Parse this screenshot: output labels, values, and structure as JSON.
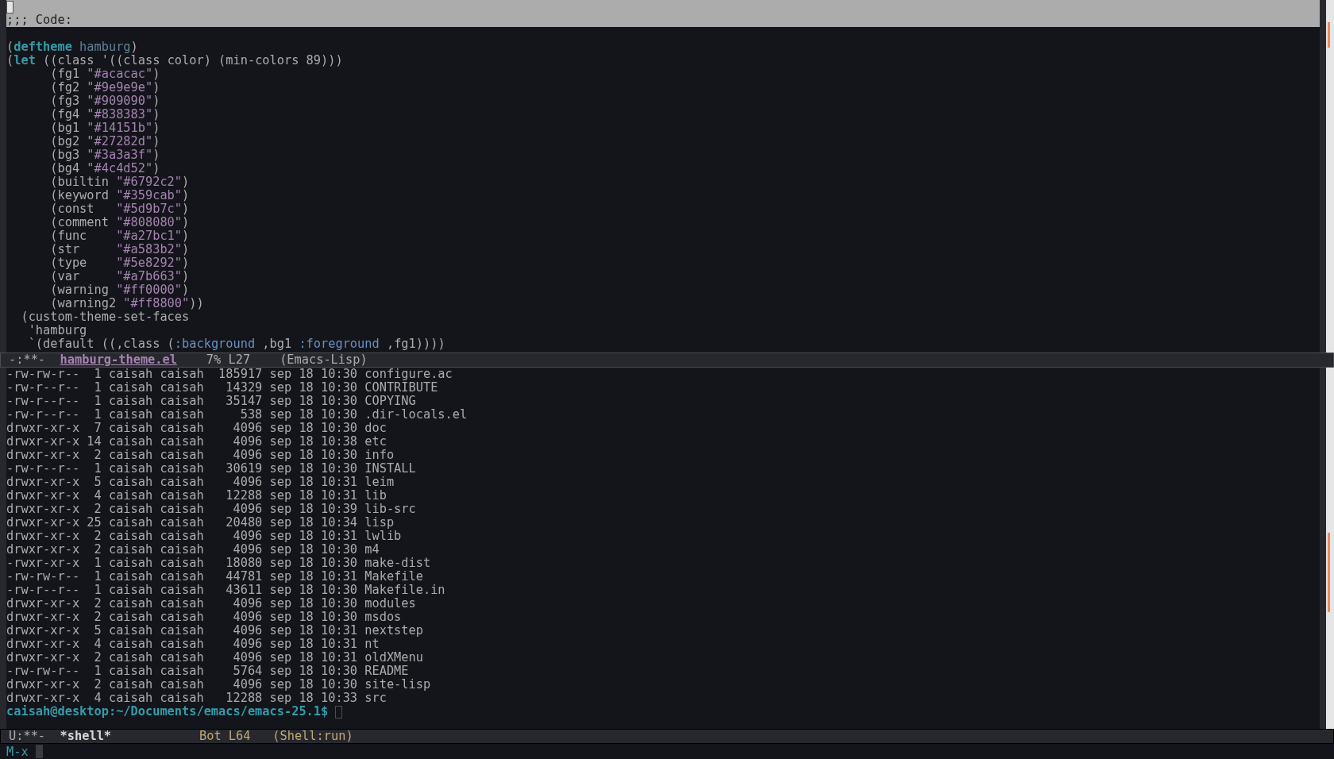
{
  "code_buffer": {
    "header_lines": [
      {
        "cursor": true
      },
      {
        "text": ";;; Code:",
        "cursor": false
      }
    ],
    "lines": [
      {
        "kind": "blank"
      },
      {
        "kind": "code",
        "segments": [
          {
            "text": "(",
            "kind": "plain"
          },
          {
            "text": "deftheme",
            "kind": "keyword"
          },
          {
            "text": " hamburg",
            "kind": "type"
          },
          {
            "text": ")",
            "kind": "plain"
          }
        ]
      },
      {
        "kind": "code",
        "segments": [
          {
            "text": "(",
            "kind": "plain"
          },
          {
            "text": "let",
            "kind": "keyword"
          },
          {
            "text": " ((class '((class color) (min-colors 89)))",
            "kind": "plain"
          }
        ]
      },
      {
        "kind": "code",
        "segments": [
          {
            "text": "      (fg1 ",
            "kind": "plain"
          },
          {
            "text": "\"#acacac\"",
            "kind": "string"
          },
          {
            "text": ")",
            "kind": "plain"
          }
        ]
      },
      {
        "kind": "code",
        "segments": [
          {
            "text": "      (fg2 ",
            "kind": "plain"
          },
          {
            "text": "\"#9e9e9e\"",
            "kind": "string"
          },
          {
            "text": ")",
            "kind": "plain"
          }
        ]
      },
      {
        "kind": "code",
        "segments": [
          {
            "text": "      (fg3 ",
            "kind": "plain"
          },
          {
            "text": "\"#909090\"",
            "kind": "string"
          },
          {
            "text": ")",
            "kind": "plain"
          }
        ]
      },
      {
        "kind": "code",
        "segments": [
          {
            "text": "      (fg4 ",
            "kind": "plain"
          },
          {
            "text": "\"#838383\"",
            "kind": "string"
          },
          {
            "text": ")",
            "kind": "plain"
          }
        ]
      },
      {
        "kind": "code",
        "segments": [
          {
            "text": "      (bg1 ",
            "kind": "plain"
          },
          {
            "text": "\"#14151b\"",
            "kind": "string"
          },
          {
            "text": ")",
            "kind": "plain"
          }
        ]
      },
      {
        "kind": "code",
        "segments": [
          {
            "text": "      (bg2 ",
            "kind": "plain"
          },
          {
            "text": "\"#27282d\"",
            "kind": "string"
          },
          {
            "text": ")",
            "kind": "plain"
          }
        ]
      },
      {
        "kind": "code",
        "segments": [
          {
            "text": "      (bg3 ",
            "kind": "plain"
          },
          {
            "text": "\"#3a3a3f\"",
            "kind": "string"
          },
          {
            "text": ")",
            "kind": "plain"
          }
        ]
      },
      {
        "kind": "code",
        "segments": [
          {
            "text": "      (bg4 ",
            "kind": "plain"
          },
          {
            "text": "\"#4c4d52\"",
            "kind": "string"
          },
          {
            "text": ")",
            "kind": "plain"
          }
        ]
      },
      {
        "kind": "code",
        "segments": [
          {
            "text": "      (builtin ",
            "kind": "plain"
          },
          {
            "text": "\"#6792c2\"",
            "kind": "string"
          },
          {
            "text": ")",
            "kind": "plain"
          }
        ]
      },
      {
        "kind": "code",
        "segments": [
          {
            "text": "      (keyword ",
            "kind": "plain"
          },
          {
            "text": "\"#359cab\"",
            "kind": "string"
          },
          {
            "text": ")",
            "kind": "plain"
          }
        ]
      },
      {
        "kind": "code",
        "segments": [
          {
            "text": "      (const   ",
            "kind": "plain"
          },
          {
            "text": "\"#5d9b7c\"",
            "kind": "string"
          },
          {
            "text": ")",
            "kind": "plain"
          }
        ]
      },
      {
        "kind": "code",
        "segments": [
          {
            "text": "      (comment ",
            "kind": "plain"
          },
          {
            "text": "\"#808080\"",
            "kind": "string"
          },
          {
            "text": ")",
            "kind": "plain"
          }
        ]
      },
      {
        "kind": "code",
        "segments": [
          {
            "text": "      (func    ",
            "kind": "plain"
          },
          {
            "text": "\"#a27bc1\"",
            "kind": "string"
          },
          {
            "text": ")",
            "kind": "plain"
          }
        ]
      },
      {
        "kind": "code",
        "segments": [
          {
            "text": "      (str     ",
            "kind": "plain"
          },
          {
            "text": "\"#a583b2\"",
            "kind": "string"
          },
          {
            "text": ")",
            "kind": "plain"
          }
        ]
      },
      {
        "kind": "code",
        "segments": [
          {
            "text": "      (type    ",
            "kind": "plain"
          },
          {
            "text": "\"#5e8292\"",
            "kind": "string"
          },
          {
            "text": ")",
            "kind": "plain"
          }
        ]
      },
      {
        "kind": "code",
        "segments": [
          {
            "text": "      (var     ",
            "kind": "plain"
          },
          {
            "text": "\"#a7b663\"",
            "kind": "string"
          },
          {
            "text": ")",
            "kind": "plain"
          }
        ]
      },
      {
        "kind": "code",
        "segments": [
          {
            "text": "      (warning ",
            "kind": "plain"
          },
          {
            "text": "\"#ff0000\"",
            "kind": "string"
          },
          {
            "text": ")",
            "kind": "plain"
          }
        ]
      },
      {
        "kind": "code",
        "segments": [
          {
            "text": "      (warning2 ",
            "kind": "plain"
          },
          {
            "text": "\"#ff8800\"",
            "kind": "string"
          },
          {
            "text": "))",
            "kind": "plain"
          }
        ]
      },
      {
        "kind": "code",
        "segments": [
          {
            "text": "  (custom-theme-set-faces",
            "kind": "plain"
          }
        ]
      },
      {
        "kind": "code",
        "segments": [
          {
            "text": "   'hamburg",
            "kind": "plain"
          }
        ]
      },
      {
        "kind": "code",
        "segments": [
          {
            "text": "   `(default ((,class (",
            "kind": "plain"
          },
          {
            "text": ":background",
            "kind": "builtin"
          },
          {
            "text": " ,bg1 ",
            "kind": "plain"
          },
          {
            "text": ":foreground",
            "kind": "builtin"
          },
          {
            "text": " ,fg1))))",
            "kind": "plain"
          }
        ]
      }
    ]
  },
  "mode_lines": [
    {
      "status": "-:**-",
      "buffer": "hamburg-theme.el",
      "position": "7% L27",
      "mode": "(Emacs-Lisp)",
      "active": false
    },
    {
      "status": "U:**-",
      "buffer": "*shell*",
      "position": "Bot L64",
      "mode": "(Shell:run)",
      "active": true
    }
  ],
  "shell_buffer": {
    "lines": [
      "-rw-rw-r--  1 caisah caisah  185917 sep 18 10:30 configure.ac",
      "-rw-r--r--  1 caisah caisah   14329 sep 18 10:30 CONTRIBUTE",
      "-rw-r--r--  1 caisah caisah   35147 sep 18 10:30 COPYING",
      "-rw-r--r--  1 caisah caisah     538 sep 18 10:30 .dir-locals.el",
      "drwxr-xr-x  7 caisah caisah    4096 sep 18 10:30 doc",
      "drwxr-xr-x 14 caisah caisah    4096 sep 18 10:38 etc",
      "drwxr-xr-x  2 caisah caisah    4096 sep 18 10:30 info",
      "-rw-r--r--  1 caisah caisah   30619 sep 18 10:30 INSTALL",
      "drwxr-xr-x  5 caisah caisah    4096 sep 18 10:31 leim",
      "drwxr-xr-x  4 caisah caisah   12288 sep 18 10:31 lib",
      "drwxr-xr-x  2 caisah caisah    4096 sep 18 10:39 lib-src",
      "drwxr-xr-x 25 caisah caisah   20480 sep 18 10:34 lisp",
      "drwxr-xr-x  2 caisah caisah    4096 sep 18 10:31 lwlib",
      "drwxr-xr-x  2 caisah caisah    4096 sep 18 10:30 m4",
      "-rwxr-xr-x  1 caisah caisah   18080 sep 18 10:30 make-dist",
      "-rw-rw-r--  1 caisah caisah   44781 sep 18 10:31 Makefile",
      "-rw-r--r--  1 caisah caisah   43611 sep 18 10:30 Makefile.in",
      "drwxr-xr-x  2 caisah caisah    4096 sep 18 10:30 modules",
      "drwxr-xr-x  2 caisah caisah    4096 sep 18 10:30 msdos",
      "drwxr-xr-x  5 caisah caisah    4096 sep 18 10:31 nextstep",
      "drwxr-xr-x  4 caisah caisah    4096 sep 18 10:31 nt",
      "drwxr-xr-x  2 caisah caisah    4096 sep 18 10:31 oldXMenu",
      "-rw-rw-r--  1 caisah caisah    5764 sep 18 10:30 README",
      "drwxr-xr-x  2 caisah caisah    4096 sep 18 10:30 site-lisp",
      "drwxr-xr-x  4 caisah caisah   12288 sep 18 10:33 src"
    ],
    "prompt": {
      "text": "caisah@desktop:~/Documents/emacs/emacs-25.1$",
      "cursor": true
    }
  },
  "minibuffer": {
    "prompt": "M-x"
  }
}
